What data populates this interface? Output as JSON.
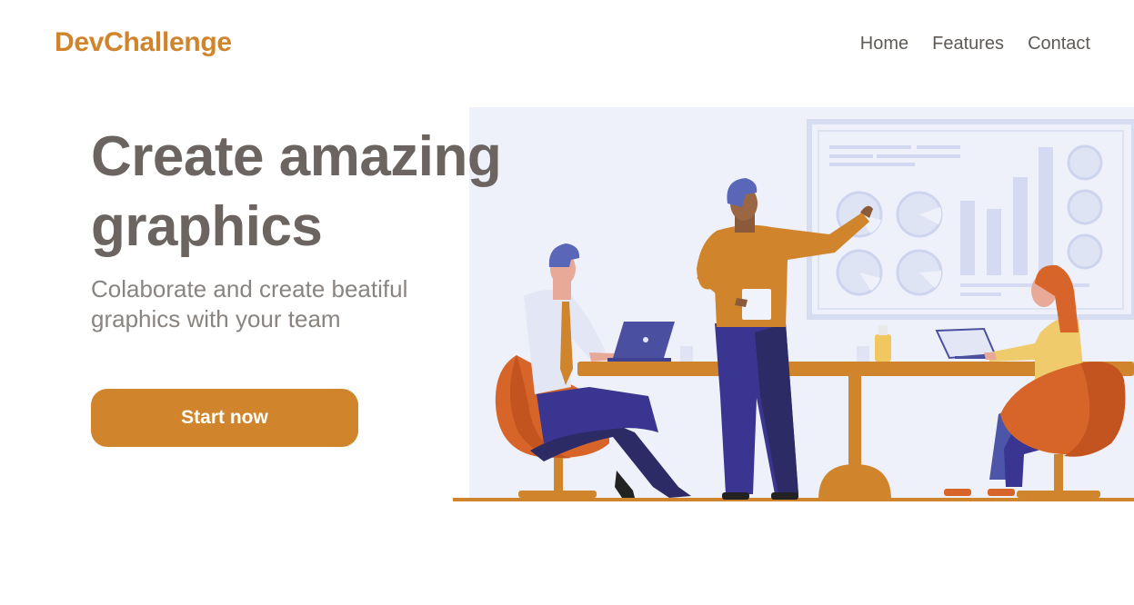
{
  "header": {
    "logo": "DevChallenge",
    "nav": [
      "Home",
      "Features",
      "Contact"
    ]
  },
  "hero": {
    "title_line1": "Create amazing",
    "title_line2": "graphics",
    "subtitle_line1": "Colaborate and create beatiful",
    "subtitle_line2": "graphics with your team",
    "cta_label": "Start now"
  },
  "colors": {
    "brand": "#d0852c",
    "heading": "#6b6460",
    "text": "#8a8480",
    "illustration_bg": "#eef1fa"
  }
}
